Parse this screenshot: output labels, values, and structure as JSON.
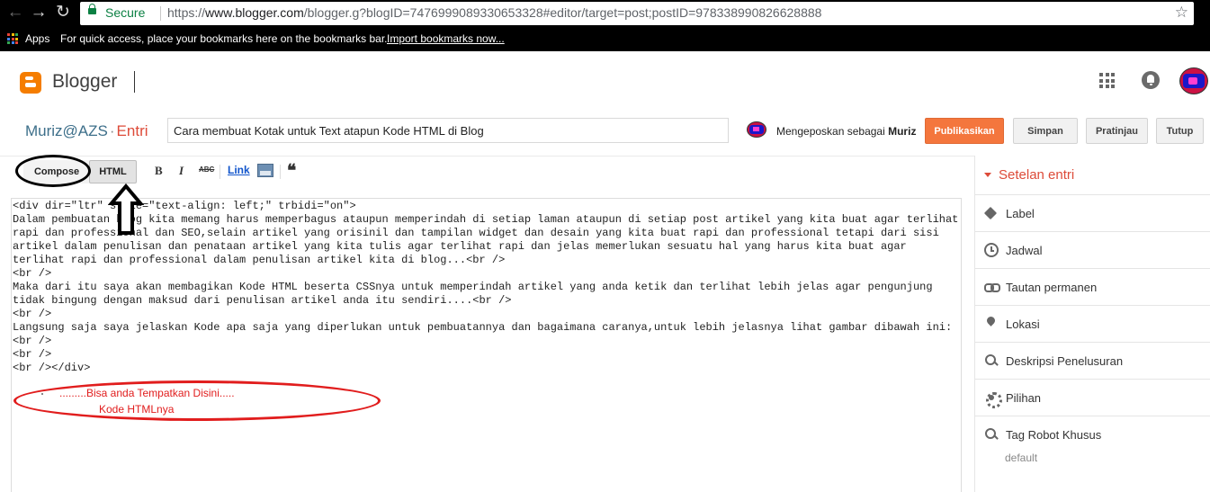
{
  "browser": {
    "secure_label": "Secure",
    "url_scheme": "https://",
    "url_host": "www.blogger.com",
    "url_path": "/blogger.g?blogID=7476999089330653328#editor/target=post;postID=978338990826628888",
    "bookmarks": {
      "apps_label": "Apps",
      "hint_text": "For quick access, place your bookmarks here on the bookmarks bar.",
      "import_link": "Import bookmarks now..."
    }
  },
  "header": {
    "app_name": "Blogger"
  },
  "entry": {
    "blog_name": "Muriz@AZS",
    "separator": "·",
    "section_label": "Entri",
    "post_title": "Cara membuat Kotak untuk Text atapun Kode HTML di Blog",
    "posting_as_prefix": "Mengeposkan sebagai",
    "author": "Muriz"
  },
  "actions": {
    "publish": "Publikasikan",
    "save": "Simpan",
    "preview": "Pratinjau",
    "close": "Tutup"
  },
  "toolbar": {
    "compose": "Compose",
    "html": "HTML",
    "bold": "B",
    "italic": "I",
    "strike": "ABC",
    "link": "Link",
    "quote": "❝"
  },
  "editor": {
    "line1": "<div dir=\"ltr\" style=\"text-align: left;\" trbidi=\"on\">",
    "para1": "Dalam pembuatan blog kita memang harus memperbagus ataupun memperindah di setiap laman ataupun di setiap post artikel yang kita buat agar terlihat rapi dan professional dan SEO,selain artikel yang orisinil dan tampilan widget dan desain yang kita buat rapi dan professional tetapi dari sisi artikel dalam penulisan dan penataan artikel yang kita tulis agar terlihat rapi dan jelas memerlukan sesuatu hal yang harus kita buat agar terlihat rapi dan professional dalam penulisan artikel kita di blog...<br />",
    "br1": "<br />",
    "para2": "Maka dari itu saya akan membagikan Kode HTML beserta CSSnya untuk memperindah artikel yang anda ketik dan terlihat lebih jelas agar pengunjung tidak bingung dengan maksud dari penulisan artikel anda itu sendiri....<br />",
    "br2": "<br />",
    "para3": "Langsung saja saya jelaskan Kode apa saja yang diperlukan untuk pembuatannya dan bagaimana caranya,untuk lebih jelasnya lihat gambar dibawah ini:",
    "br3": "<br />",
    "br4": "<br />",
    "close_line": "<br /></div>"
  },
  "annotations": {
    "note_line1": ".........Bisa anda Tempatkan Disini.....",
    "note_line2": "Kode HTMLnya",
    "note_color": "#e11d1d"
  },
  "sidebar": {
    "title": "Setelan entri",
    "items": [
      {
        "label": "Label",
        "icon": "label-icon"
      },
      {
        "label": "Jadwal",
        "icon": "clock-icon"
      },
      {
        "label": "Tautan permanen",
        "icon": "link-icon"
      },
      {
        "label": "Lokasi",
        "icon": "location-pin-icon"
      },
      {
        "label": "Deskripsi Penelusuran",
        "icon": "search-icon"
      },
      {
        "label": "Pilihan",
        "icon": "gear-icon"
      },
      {
        "label": "Tag Robot Khusus",
        "icon": "search-icon"
      }
    ],
    "robot_tag_value": "default"
  },
  "colors": {
    "publish": "#f4763d",
    "accent": "#dd4b39",
    "blog_name": "#3d6f8a",
    "secure": "#0b8043"
  }
}
